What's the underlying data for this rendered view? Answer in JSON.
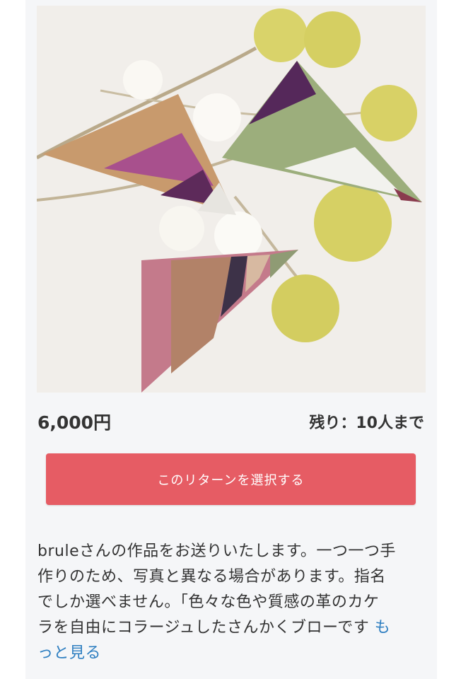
{
  "reward": {
    "price": "6,000円",
    "remaining": "残り：10人まで",
    "select_label": "このリターンを選択する",
    "description_lines": [
      "bruleさんの作品をお送りいたします。一つ一つ手",
      "作りのため、写真と異なる場合があります。指名",
      "でしか選べません。「色々な色や質感の革のカケ",
      "ラを自由にコラージュしたさんかくブローです"
    ],
    "more_label_part1": "も",
    "more_label_part2": "っと見る"
  },
  "colors": {
    "accent": "#e65c64",
    "link": "#2f7fc1",
    "text": "#333333"
  }
}
